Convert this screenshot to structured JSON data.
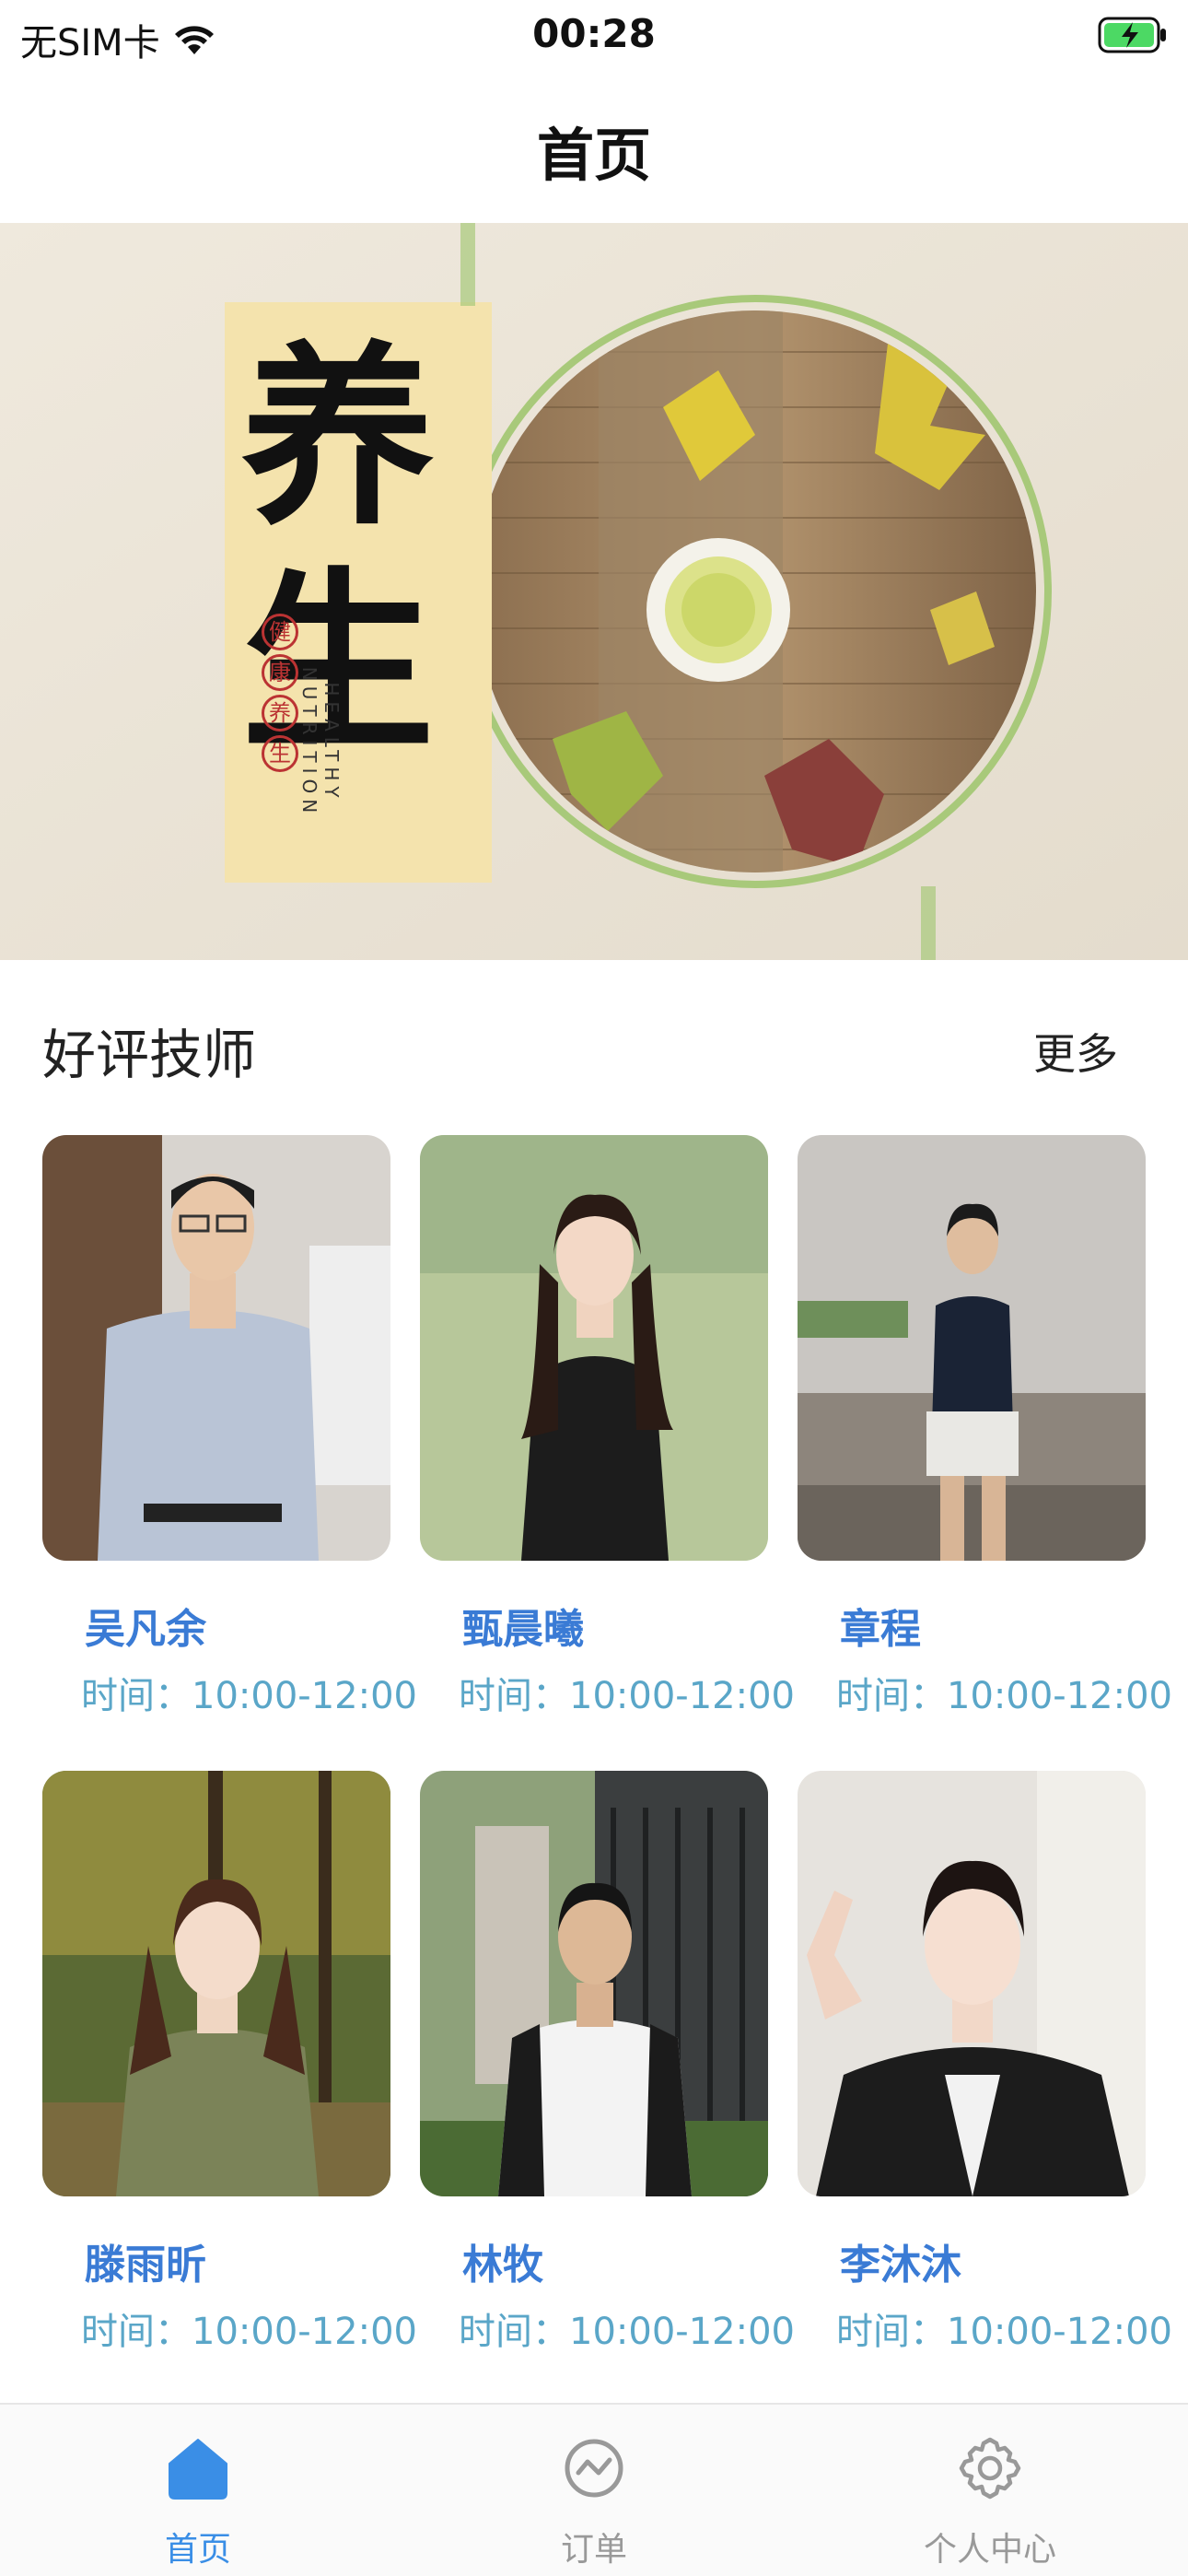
{
  "status_bar": {
    "carrier": "无SIM卡",
    "time": "00:28"
  },
  "nav": {
    "title": "首页"
  },
  "banner": {
    "headline": "养生",
    "badges": [
      "健",
      "康",
      "养",
      "生"
    ],
    "subtitle": "HEALTHY NUTRITION"
  },
  "section": {
    "title": "好评技师",
    "more_label": "更多"
  },
  "technicians": [
    {
      "name": "吴凡余",
      "time": "时间：10:00-12:00"
    },
    {
      "name": "甄晨曦",
      "time": "时间：10:00-12:00"
    },
    {
      "name": "章程",
      "time": "时间：10:00-12:00"
    },
    {
      "name": "滕雨昕",
      "time": "时间：10:00-12:00"
    },
    {
      "name": "林牧",
      "time": "时间：10:00-12:00"
    },
    {
      "name": "李沐沐",
      "time": "时间：10:00-12:00"
    }
  ],
  "tab_bar": {
    "tabs": [
      {
        "label": "首页",
        "icon": "home-icon",
        "active": true
      },
      {
        "label": "订单",
        "icon": "order-icon",
        "active": false
      },
      {
        "label": "个人中心",
        "icon": "settings-icon",
        "active": false
      }
    ]
  },
  "colors": {
    "accent": "#3a8ee6",
    "name_text": "#3a7bd5",
    "time_text": "#5aa6c8",
    "inactive_tab": "#999999"
  }
}
